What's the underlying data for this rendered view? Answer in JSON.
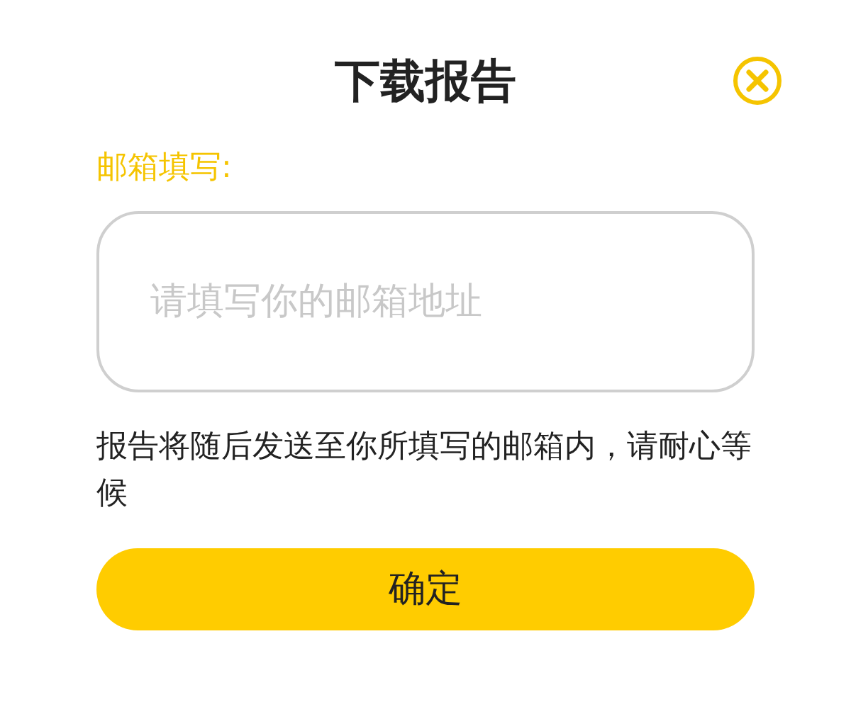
{
  "dialog": {
    "title": "下载报告"
  },
  "email_field": {
    "label": "邮箱填写:",
    "placeholder": "请填写你的邮箱地址"
  },
  "note": "报告将随后发送至你所填写的邮箱内，请耐心等候",
  "confirm_button": {
    "label": "确定"
  }
}
